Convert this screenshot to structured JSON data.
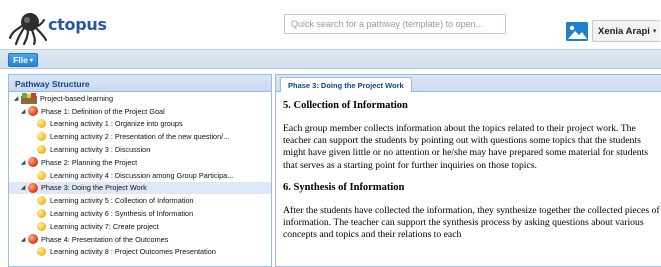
{
  "app": {
    "logo_text": "ctopus",
    "search_placeholder": "Quick search for a pathway (template) to open...",
    "user_name": "Xenia Arapi",
    "file_menu": "File",
    "colors": {
      "accent": "#2a84d3",
      "panel_header": "#15428b",
      "selection": "#dfe8f6"
    }
  },
  "left_panel": {
    "title": "Pathway Structure",
    "tree": [
      {
        "label": "Project-based learning",
        "type": "project",
        "level": 0,
        "expanded": true
      },
      {
        "label": "Phase 1: Definition of the Project Goal",
        "type": "phase",
        "level": 1,
        "expanded": true
      },
      {
        "label": "Learning activity 1 : Organize into groups",
        "type": "activity",
        "level": 2
      },
      {
        "label": "Learning activity 2 : Presentation of the new question/...",
        "type": "activity",
        "level": 2
      },
      {
        "label": "Learning activity 3 : Discussion",
        "type": "activity",
        "level": 2
      },
      {
        "label": "Phase 2: Planning the Project",
        "type": "phase",
        "level": 1,
        "expanded": true
      },
      {
        "label": "Learning activity 4 : Discussion among Group Participa...",
        "type": "activity",
        "level": 2
      },
      {
        "label": "Phase 3: Doing the Project Work",
        "type": "phase",
        "level": 1,
        "expanded": true,
        "selected": true
      },
      {
        "label": "Learning activity 5 : Collection of Information",
        "type": "activity",
        "level": 2
      },
      {
        "label": "Learning activity 6 : Synthesis of Information",
        "type": "activity",
        "level": 2
      },
      {
        "label": "Learning activity 7: Create project",
        "type": "activity",
        "level": 2
      },
      {
        "label": "Phase 4: Presentation of the Outcomes",
        "type": "phase",
        "level": 1,
        "expanded": true
      },
      {
        "label": "Learning activity 8 : Project Outcomes Presentation",
        "type": "activity",
        "level": 2
      }
    ]
  },
  "right_panel": {
    "tab_label": "Phase 3: Doing the Project Work",
    "sections": [
      {
        "heading": "5. Collection of Information",
        "body": "Each group member collects information about the topics related to their project work. The teacher can support the students by pointing out with questions some topics that the students might have given little or no attention or he/she may have prepared some material for students that serves as a starting point for further inquiries on those topics."
      },
      {
        "heading": "6. Synthesis of Information",
        "body": "After the students have collected the information, they synthesize together the collected pieces of information. The teacher can support the synthesis process by asking questions about various concepts and topics and their relations to each"
      }
    ]
  }
}
